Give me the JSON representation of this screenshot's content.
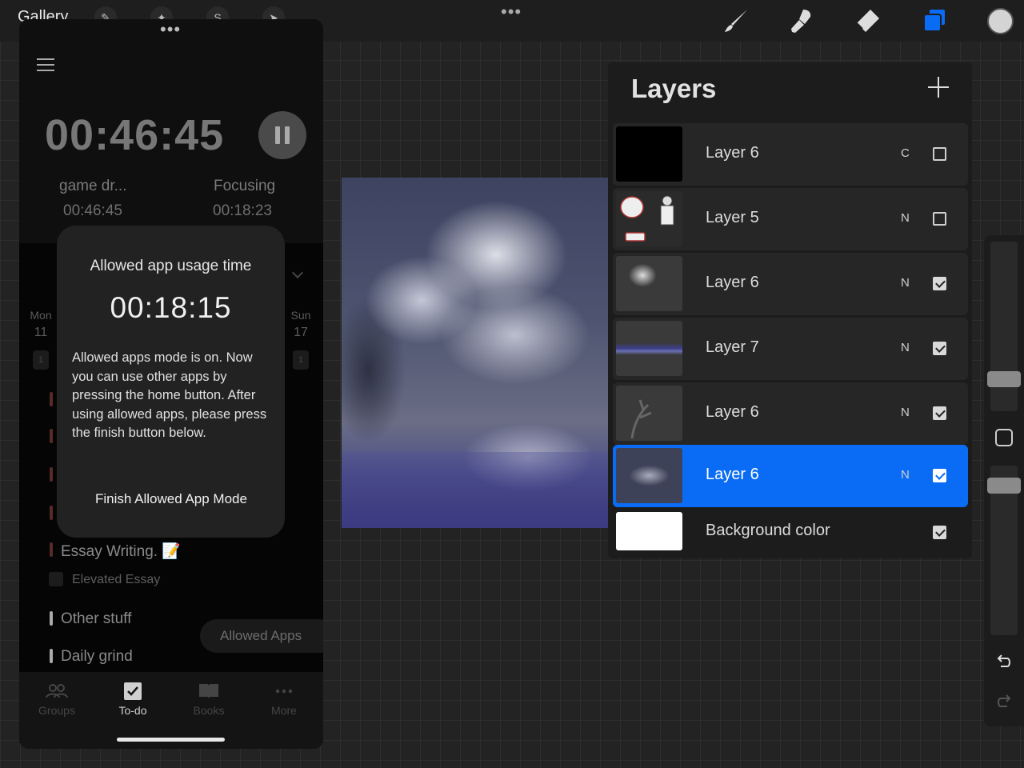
{
  "toolbar": {
    "gallery": "Gallery",
    "dots": "•••",
    "tools": [
      "brush-icon",
      "smudge-icon",
      "eraser-icon",
      "layers-icon"
    ],
    "active_tool": "layers-icon",
    "accent": "#0a6cf5",
    "current_color": "#d4d4d4"
  },
  "layers": {
    "title": "Layers",
    "items": [
      {
        "name": "Layer 6",
        "blend": "C",
        "visible": false,
        "selected": false
      },
      {
        "name": "Layer 5",
        "blend": "N",
        "visible": false,
        "selected": false
      },
      {
        "name": "Layer 6",
        "blend": "N",
        "visible": true,
        "selected": false
      },
      {
        "name": "Layer 7",
        "blend": "N",
        "visible": true,
        "selected": false
      },
      {
        "name": "Layer 6",
        "blend": "N",
        "visible": true,
        "selected": false
      },
      {
        "name": "Layer 6",
        "blend": "N",
        "visible": true,
        "selected": true
      },
      {
        "name": "Background color",
        "blend": "",
        "visible": true,
        "selected": false
      }
    ]
  },
  "focus_app": {
    "dots": "•••",
    "timer": "00:46:45",
    "stats": [
      {
        "label": "game dr...",
        "value": "00:46:45"
      },
      {
        "label": "Focusing",
        "value": "00:18:23"
      }
    ],
    "week": {
      "start_day": "Mon",
      "start_num": "11",
      "start_count": "1",
      "end_day": "Sun",
      "end_num": "17",
      "end_count": "1"
    },
    "tasks": [
      {
        "title": "Essay Writing. 📝",
        "sub": "Elevated Essay"
      },
      {
        "title": "Other stuff"
      },
      {
        "title": "Daily grind"
      }
    ],
    "allowed_apps_button": "Allowed Apps",
    "tabs": [
      {
        "label": "Groups",
        "icon": "groups-icon"
      },
      {
        "label": "To-do",
        "icon": "todo-check-icon"
      },
      {
        "label": "Books",
        "icon": "book-icon"
      },
      {
        "label": "More",
        "icon": "more-dots-icon"
      }
    ],
    "active_tab": "To-do"
  },
  "dialog": {
    "title": "Allowed app usage time",
    "timer": "00:18:15",
    "body": "Allowed apps mode is on. Now you can use other apps by pressing the home button. After using allowed apps, please press the finish button below.",
    "finish_button": "Finish Allowed App Mode"
  }
}
